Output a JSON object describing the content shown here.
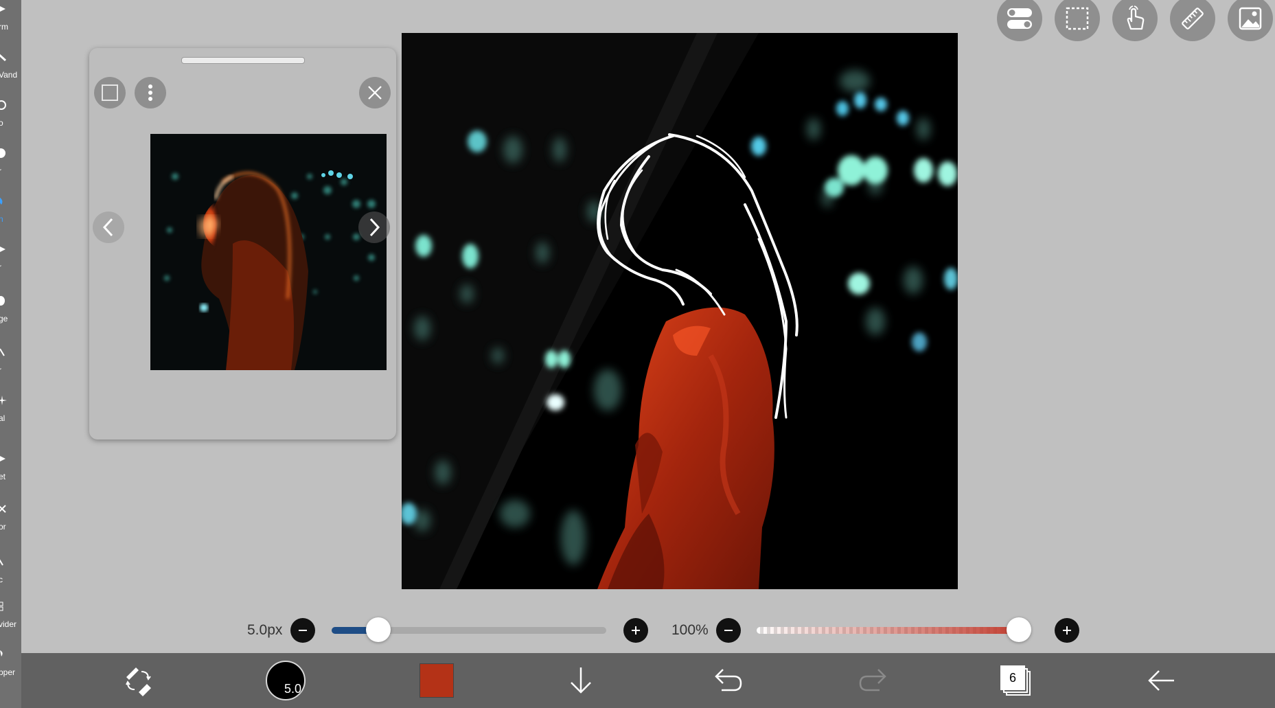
{
  "left_toolbar": {
    "items": [
      {
        "label": "rm",
        "icon": "transform-icon"
      },
      {
        "label": "Vand",
        "icon": "magic-wand-icon"
      },
      {
        "label": "o",
        "icon": "lasso-icon"
      },
      {
        "label": "r",
        "icon": "filter-icon"
      },
      {
        "label": "n",
        "icon": "brush-icon"
      },
      {
        "label": "r",
        "icon": "eraser-icon"
      },
      {
        "label": "ge",
        "icon": "smudge-icon"
      },
      {
        "label": "r",
        "icon": "blur-icon"
      },
      {
        "label": "al",
        "icon": "special-icon"
      },
      {
        "label": "et",
        "icon": "bucket-icon"
      },
      {
        "label": "or",
        "icon": "text-icon"
      },
      {
        "label": "c",
        "icon": "frame-icon"
      },
      {
        "label": "vider",
        "icon": "frame-divider-icon"
      },
      {
        "label": "pper",
        "icon": "eyedropper-icon"
      }
    ],
    "active_index": 4
  },
  "top_right_buttons": [
    {
      "name": "toggle-settings-button",
      "icon": "toggle-icon"
    },
    {
      "name": "selection-button",
      "icon": "selection-icon"
    },
    {
      "name": "hand-tool-button",
      "icon": "hand-icon"
    },
    {
      "name": "ruler-button",
      "icon": "ruler-icon"
    },
    {
      "name": "material-button",
      "icon": "image-icon"
    }
  ],
  "reference_panel": {
    "controls": [
      "square-icon",
      "more-vertical-icon",
      "close-icon"
    ],
    "prev_icon": "chevron-left-icon",
    "next_icon": "chevron-right-icon"
  },
  "brush": {
    "size_label": "5.0px",
    "size_fraction": 0.17,
    "opacity_label": "100%",
    "opacity_fraction": 1.0,
    "size_badge": "5.0"
  },
  "bottom_bar": {
    "current_color": "#b43217",
    "layers_count": "6",
    "items": [
      "brush-eraser-toggle-icon",
      "brush-size-icon",
      "color-swatch",
      "download-icon",
      "undo-icon",
      "redo-icon",
      "layers-icon",
      "back-icon"
    ]
  },
  "colors": {
    "background": "#c0c0c0",
    "toolbar": "#616161",
    "accent_blue": "#1e4d86",
    "accent_red": "#c0392b",
    "active_tool": "#3aa0ff"
  }
}
